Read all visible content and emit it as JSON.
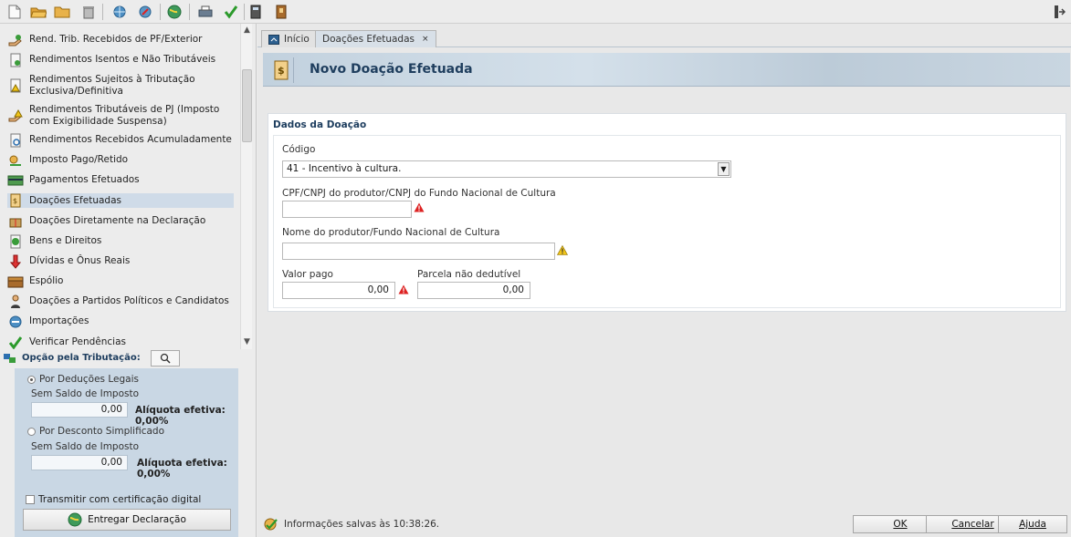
{
  "toolbar": {
    "icons": [
      "new-file-icon",
      "open-folder-icon",
      "folder-icon",
      "trash-icon",
      "network-icon",
      "network-sync-icon",
      "globe-icon",
      "print-icon",
      "checkmark-icon",
      "calculator-icon",
      "book-icon",
      "exit-icon"
    ]
  },
  "sidebar": {
    "items": [
      {
        "label": "Rend. Trib. Recebidos de PF/Exterior",
        "icon": "hand-money-icon"
      },
      {
        "label": "Rendimentos Isentos e Não Tributáveis",
        "icon": "document-icon"
      },
      {
        "label": "Rendimentos Sujeitos à Tributação Exclusiva/Definitiva",
        "icon": "warning-document-icon"
      },
      {
        "label": "Rendimentos Tributáveis de PJ (Imposto com Exigibilidade Suspensa)",
        "icon": "hand-warning-icon"
      },
      {
        "label": "Rendimentos Recebidos Acumuladamente",
        "icon": "document-search-icon"
      },
      {
        "label": "Imposto Pago/Retido",
        "icon": "tax-icon"
      },
      {
        "label": "Pagamentos Efetuados",
        "icon": "card-icon"
      },
      {
        "label": "Doações Efetuadas",
        "icon": "money-bag-icon"
      },
      {
        "label": "Doações Diretamente na Declaração",
        "icon": "gift-icon"
      },
      {
        "label": "Bens e Direitos",
        "icon": "coins-icon"
      },
      {
        "label": "Dívidas e Ônus Reais",
        "icon": "down-arrow-icon"
      },
      {
        "label": "Espólio",
        "icon": "chest-icon"
      },
      {
        "label": "Doações a Partidos Políticos e Candidatos",
        "icon": "person-icon"
      },
      {
        "label": "Importações",
        "icon": "import-icon"
      },
      {
        "label": "Verificar Pendências",
        "icon": "check-icon"
      }
    ],
    "selected_index": 7,
    "option_header": "Opção pela Tributação:",
    "deducoes": {
      "label": "Por Deduções Legais",
      "sublabel": "Sem Saldo de Imposto",
      "value": "0,00",
      "aliquota": "Alíquota efetiva: 0,00%"
    },
    "simplificado": {
      "label": "Por Desconto Simplificado",
      "sublabel": "Sem Saldo de Imposto",
      "value": "0,00",
      "aliquota": "Alíquota efetiva: 0,00%"
    },
    "transmitir_label": "Transmitir com certificação digital",
    "entregar_label": "Entregar Declaração"
  },
  "tabs": [
    {
      "label": "Início"
    },
    {
      "label": "Doações Efetuadas",
      "close": "×"
    }
  ],
  "banner": {
    "title": "Novo Doação Efetuada"
  },
  "form": {
    "section_title": "Dados da Doação",
    "codigo_label": "Código",
    "codigo_value": "41 - Incentivo à cultura.",
    "cpf_label": "CPF/CNPJ do produtor/CNPJ do Fundo Nacional de Cultura",
    "cpf_value": "",
    "nome_label": "Nome do produtor/Fundo Nacional de Cultura",
    "nome_value": "",
    "valor_label": "Valor pago",
    "valor_value": "0,00",
    "parcela_label": "Parcela não dedutível",
    "parcela_value": "0,00"
  },
  "status_text": "Informações salvas às 10:38:26.",
  "buttons": {
    "ok": "OK",
    "cancel": "Cancelar",
    "help": "Ajuda"
  },
  "colors": {
    "accent": "#1f3e5e",
    "selected": "#cfdbe8",
    "error": "#d22",
    "warning": "#e8c21c"
  }
}
